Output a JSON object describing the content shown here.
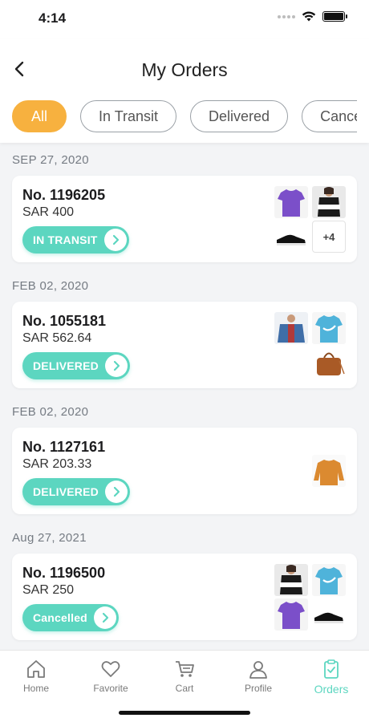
{
  "status_bar": {
    "time": "4:14"
  },
  "header": {
    "title": "My Orders"
  },
  "tabs": [
    {
      "label": "All",
      "active": true
    },
    {
      "label": "In Transit",
      "active": false
    },
    {
      "label": "Delivered",
      "active": false
    },
    {
      "label": "Cancelled",
      "active": false
    }
  ],
  "orders": [
    {
      "date": "SEP 27, 2020",
      "number": "No. 1196205",
      "price": "SAR 400",
      "status": "IN TRANSIT",
      "items": [
        "purple-tshirt",
        "black-white-top",
        "black-sneaker"
      ],
      "more_count": "+4"
    },
    {
      "date": "FEB 02, 2020",
      "number": "No. 1055181",
      "price": "SAR 562.64",
      "status": "DELIVERED",
      "items": [
        "denim-jacket",
        "blue-tshirt",
        "brown-bag"
      ]
    },
    {
      "date": "FEB 02, 2020",
      "number": "No. 1127161",
      "price": "SAR 203.33",
      "status": "DELIVERED",
      "items": [
        "orange-sweater"
      ]
    },
    {
      "date": "Aug 27, 2021",
      "number": "No. 1196500",
      "price": "SAR 250",
      "status": "Cancelled",
      "items": [
        "black-white-top",
        "blue-tshirt",
        "purple-tshirt",
        "black-sneaker"
      ]
    }
  ],
  "bottom_nav": [
    {
      "label": "Home",
      "icon": "home-icon"
    },
    {
      "label": "Favorite",
      "icon": "heart-icon"
    },
    {
      "label": "Cart",
      "icon": "cart-icon"
    },
    {
      "label": "Profile",
      "icon": "profile-icon"
    },
    {
      "label": "Orders",
      "icon": "orders-icon",
      "active": true
    }
  ],
  "colors": {
    "accent": "#5cd6c0",
    "tab_active": "#f7b13f"
  }
}
